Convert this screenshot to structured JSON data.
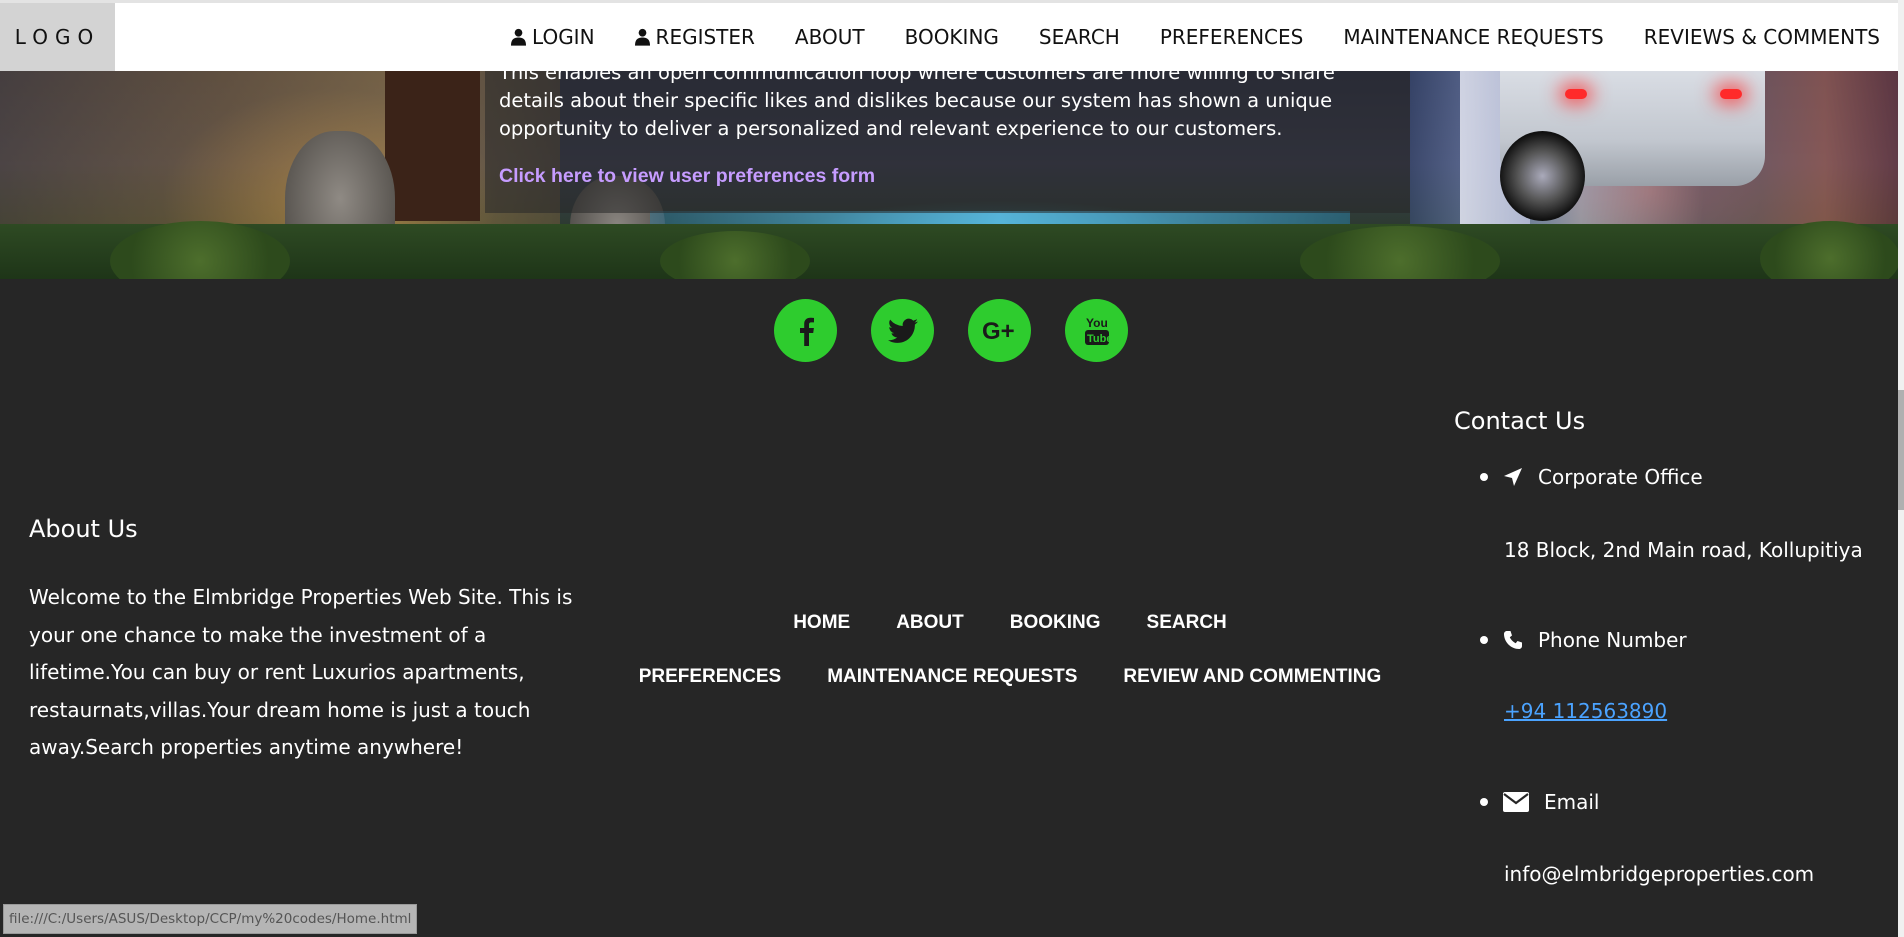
{
  "nav": {
    "logo": "LOGO",
    "items": [
      {
        "label": "LOGIN",
        "icon": "user-icon"
      },
      {
        "label": "REGISTER",
        "icon": "user-icon"
      },
      {
        "label": "ABOUT"
      },
      {
        "label": "BOOKING"
      },
      {
        "label": "SEARCH"
      },
      {
        "label": "PREFERENCES"
      },
      {
        "label": "MAINTENANCE REQUESTS"
      },
      {
        "label": "REVIEWS & COMMENTS"
      }
    ]
  },
  "hero": {
    "text": "This enables an open communication loop where customers are more willing to share details about their specific likes and dislikes because our system has shown a unique opportunity to deliver a personalized and relevant experience to our customers.",
    "link": "Click here to view user preferences form"
  },
  "social": [
    "facebook-icon",
    "twitter-icon",
    "google-plus-icon",
    "youtube-icon"
  ],
  "about": {
    "title": "About Us",
    "body": "Welcome to the Elmbridge Properties Web Site. This is your one chance to make the investment of a lifetime.You can buy or rent Luxurios apartments, restaurnats,villas.Your dream home is just a touch away.Search properties anytime anywhere!"
  },
  "footer_nav": {
    "row1": [
      "HOME",
      "ABOUT",
      "BOOKING",
      "SEARCH"
    ],
    "row2": [
      "PREFERENCES",
      "MAINTENANCE REQUESTS",
      "REVIEW AND COMMENTING"
    ]
  },
  "contact": {
    "title": "Contact Us",
    "items": [
      {
        "label": "Corporate Office",
        "value": "18 Block, 2nd Main road, Kollupitiya",
        "icon": "location-arrow-icon"
      },
      {
        "label": "Phone Number",
        "value": "+94 112563890",
        "icon": "phone-icon"
      },
      {
        "label": "Email",
        "value": "info@elmbridgeproperties.com",
        "icon": "envelope-icon"
      }
    ]
  },
  "status_bar": "file:///C:/Users/ASUS/Desktop/CCP/my%20codes/Home.html",
  "colors": {
    "footer_bg": "#262626",
    "social_green": "#2ecc2e",
    "hero_link": "#c69cff",
    "phone_link": "#4ba3ff"
  }
}
